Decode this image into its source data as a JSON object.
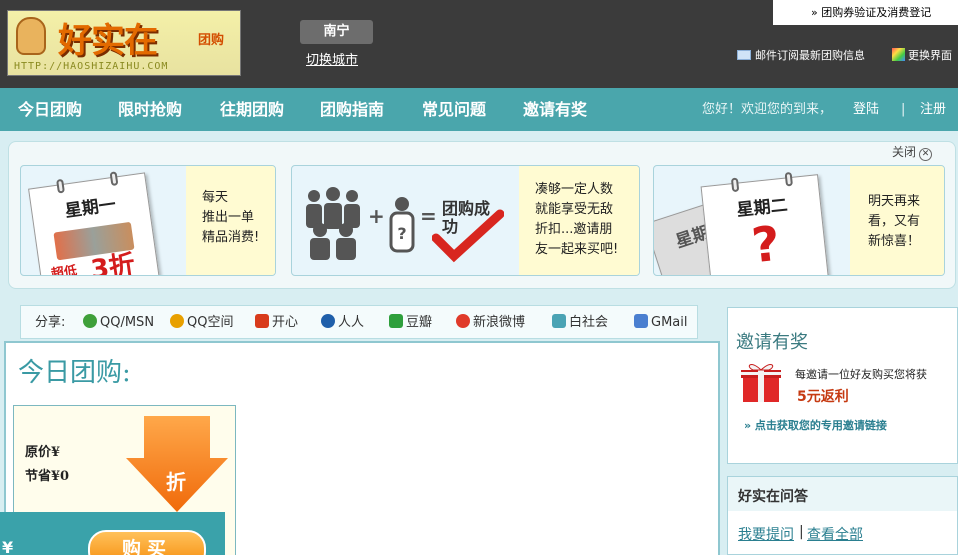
{
  "header": {
    "logo_text": "好实在",
    "logo_tag": "团购",
    "logo_url": "HTTP://HAOSHIZAIHU.COM",
    "city": "南宁",
    "switch_city": "切换城市",
    "coupon_link": "» 团购券验证及消费登记",
    "subscribe": "邮件订阅最新团购信息",
    "skin": "更换界面"
  },
  "nav": {
    "items": [
      "今日团购",
      "限时抢购",
      "往期团购",
      "团购指南",
      "常见问题",
      "邀请有奖"
    ],
    "welcome": "您好！欢迎您的到来，",
    "login": "登陆",
    "sep": "|",
    "register": "注册"
  },
  "banner": {
    "close": "关闭",
    "card1": {
      "day": "星期一",
      "promo": "超低",
      "promo_num": "3折",
      "lines": [
        "每天",
        "推出一单",
        "精品消费!"
      ]
    },
    "card2": {
      "badge": "团购成功",
      "lines": [
        "凑够一定人数",
        "就能享受无敌",
        "折扣...邀请朋",
        "友一起来买吧!"
      ]
    },
    "card3": {
      "day_back": "星期一",
      "day": "星期二",
      "lines": [
        "明天再来",
        "看，又有",
        "新惊喜！"
      ]
    }
  },
  "share": {
    "label": "分享:",
    "items": [
      {
        "label": "QQ/MSN",
        "color": "#3fa03a"
      },
      {
        "label": "QQ空间",
        "color": "#e8a000"
      },
      {
        "label": "开心",
        "color": "#d83b1c"
      },
      {
        "label": "人人",
        "color": "#1f5faa"
      },
      {
        "label": "豆瓣",
        "color": "#2e9f3c"
      },
      {
        "label": "新浪微博",
        "color": "#e03a2a"
      },
      {
        "label": "白社会",
        "color": "#4aa3b4"
      },
      {
        "label": "GMail",
        "color": "#4a7fd0"
      }
    ]
  },
  "main": {
    "title": "今日团购:",
    "original_price": "原价¥",
    "savings": "节省¥0",
    "discount_label": "折",
    "buy": "购买"
  },
  "side": {
    "invite_title": "邀请有奖",
    "invite_desc": "每邀请一位好友购买您将获",
    "rebate": "5元返利",
    "invite_link": "» 点击获取您的专用邀请链接",
    "qa_title": "好实在问答",
    "ask": "我要提问",
    "qa_sep": "|",
    "view_all": "查看全部"
  }
}
